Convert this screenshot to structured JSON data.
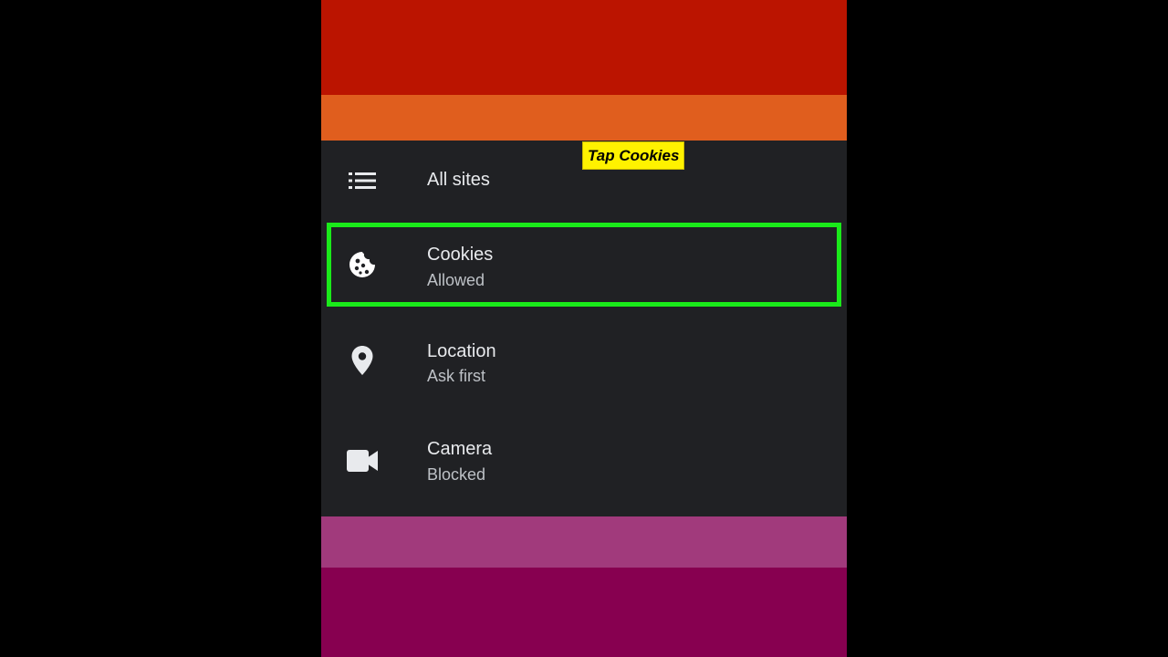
{
  "callout": {
    "text": "Tap Cookies",
    "bg_color": "#fff200"
  },
  "colors": {
    "panel_bg": "#202124",
    "highlight_border": "#1aea1a",
    "band_top": "#bb1400",
    "band_orange": "#e05e1e",
    "band_pink": "#a13a7c",
    "band_bottom": "#870050"
  },
  "site_settings": {
    "items": [
      {
        "title": "All sites",
        "icon": "list-icon"
      },
      {
        "title": "Cookies",
        "subtitle": "Allowed",
        "icon": "cookie-icon",
        "highlighted": true
      },
      {
        "title": "Location",
        "subtitle": "Ask first",
        "icon": "location-pin-icon"
      },
      {
        "title": "Camera",
        "subtitle": "Blocked",
        "icon": "videocam-icon"
      }
    ]
  }
}
